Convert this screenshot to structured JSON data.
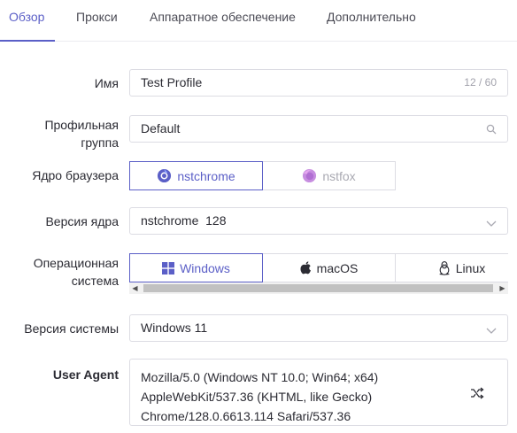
{
  "tabs": [
    {
      "label": "Обзор",
      "active": true
    },
    {
      "label": "Прокси",
      "active": false
    },
    {
      "label": "Аппаратное обеспечение",
      "active": false
    },
    {
      "label": "Дополнительно",
      "active": false
    }
  ],
  "accent_color": "#5b5fc7",
  "form": {
    "name": {
      "label": "Имя",
      "value": "Test Profile",
      "counter": "12 / 60"
    },
    "group": {
      "label_line1": "Профильная",
      "label_line2": "группа",
      "value": "Default",
      "icon": "search-icon"
    },
    "browser_core": {
      "label": "Ядро браузера",
      "options": [
        {
          "label": "nstchrome",
          "icon": "nstchrome-logo-icon",
          "selected": true
        },
        {
          "label": "nstfox",
          "icon": "nstfox-logo-icon",
          "selected": false
        }
      ]
    },
    "core_version": {
      "label": "Версия ядра",
      "value": "nstchrome  128",
      "icon": "chevron-down-icon"
    },
    "os": {
      "label_line1": "Операционная",
      "label_line2": "система",
      "options": [
        {
          "label": "Windows",
          "icon": "windows-icon",
          "selected": true
        },
        {
          "label": "macOS",
          "icon": "apple-icon",
          "selected": false
        },
        {
          "label": "Linux",
          "icon": "linux-icon",
          "selected": false
        }
      ]
    },
    "os_version": {
      "label": "Версия системы",
      "value": "Windows 11",
      "icon": "chevron-down-icon"
    },
    "user_agent": {
      "label": "User Agent",
      "lines": [
        "Mozilla/5.0 (Windows NT 10.0; Win64; x64)",
        "AppleWebKit/537.36 (KHTML, like Gecko)",
        "Chrome/128.0.6613.114 Safari/537.36"
      ],
      "icon": "shuffle-icon"
    }
  }
}
